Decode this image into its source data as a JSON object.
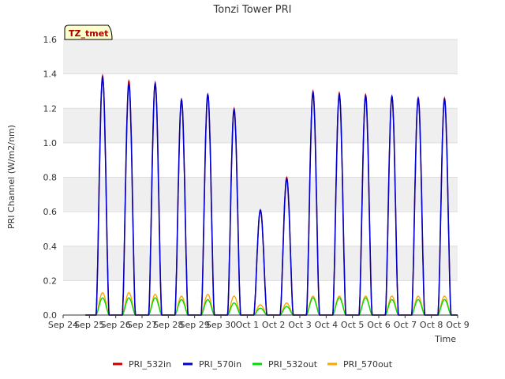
{
  "chart_data": {
    "type": "line",
    "title": "Tonzi Tower PRI",
    "xlabel": "Time",
    "ylabel": "PRI Channel (W/m2/nm)",
    "ylim": [
      0,
      1.6
    ],
    "yticks": [
      "0.0",
      "0.2",
      "0.4",
      "0.6",
      "0.8",
      "1.0",
      "1.2",
      "1.4",
      "1.6"
    ],
    "xlim": [
      "2024-09-24",
      "2024-10-09"
    ],
    "xticks": [
      "Sep 24",
      "Sep 25",
      "Sep 26",
      "Sep 27",
      "Sep 28",
      "Sep 29",
      "Sep 30",
      "Oct 1",
      "Oct 2",
      "Oct 3",
      "Oct 4",
      "Oct 5",
      "Oct 6",
      "Oct 7",
      "Oct 8",
      "Oct 9"
    ],
    "grid": true,
    "legend_position": "bottom",
    "annotation": "TZ_tmet",
    "series": [
      {
        "name": "PRI_532in",
        "color": "#cc0000",
        "daily_peak_dates": [
          "2024-09-25",
          "2024-09-26",
          "2024-09-27",
          "2024-09-28",
          "2024-09-29",
          "2024-09-30",
          "2024-10-01",
          "2024-10-02",
          "2024-10-03",
          "2024-10-04",
          "2024-10-05",
          "2024-10-06",
          "2024-10-07",
          "2024-10-08"
        ],
        "daily_peaks": [
          1.39,
          1.36,
          1.35,
          1.25,
          1.28,
          1.2,
          0.61,
          0.8,
          1.3,
          1.29,
          1.28,
          1.27,
          1.26,
          1.26
        ]
      },
      {
        "name": "PRI_570in",
        "color": "#0000cc",
        "daily_peak_dates": [
          "2024-09-25",
          "2024-09-26",
          "2024-09-27",
          "2024-09-28",
          "2024-09-29",
          "2024-09-30",
          "2024-10-01",
          "2024-10-02",
          "2024-10-03",
          "2024-10-04",
          "2024-10-05",
          "2024-10-06",
          "2024-10-07",
          "2024-10-08"
        ],
        "daily_peaks": [
          1.38,
          1.34,
          1.34,
          1.25,
          1.28,
          1.19,
          0.61,
          0.79,
          1.29,
          1.28,
          1.27,
          1.27,
          1.26,
          1.25
        ]
      },
      {
        "name": "PRI_532out",
        "color": "#00dd00",
        "daily_peak_dates": [
          "2024-09-25",
          "2024-09-26",
          "2024-09-27",
          "2024-09-28",
          "2024-09-29",
          "2024-09-30",
          "2024-10-01",
          "2024-10-02",
          "2024-10-03",
          "2024-10-04",
          "2024-10-05",
          "2024-10-06",
          "2024-10-07",
          "2024-10-08"
        ],
        "daily_peaks": [
          0.1,
          0.1,
          0.1,
          0.09,
          0.09,
          0.07,
          0.04,
          0.05,
          0.1,
          0.1,
          0.1,
          0.09,
          0.09,
          0.09
        ]
      },
      {
        "name": "PRI_570out",
        "color": "#ffa500",
        "daily_peak_dates": [
          "2024-09-25",
          "2024-09-26",
          "2024-09-27",
          "2024-09-28",
          "2024-09-29",
          "2024-09-30",
          "2024-10-01",
          "2024-10-02",
          "2024-10-03",
          "2024-10-04",
          "2024-10-05",
          "2024-10-06",
          "2024-10-07",
          "2024-10-08"
        ],
        "daily_peaks": [
          0.13,
          0.13,
          0.12,
          0.11,
          0.12,
          0.11,
          0.06,
          0.07,
          0.11,
          0.11,
          0.11,
          0.11,
          0.11,
          0.11
        ]
      }
    ]
  }
}
